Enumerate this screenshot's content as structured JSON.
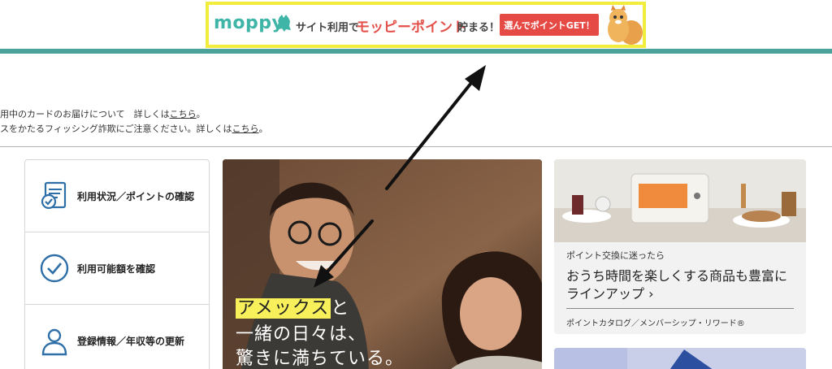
{
  "banner": {
    "logo": "moppy",
    "text_prefix": "サイト利用で",
    "text_points": "モッピーポイント",
    "text_suffix": "貯まる！",
    "cta_label": "選んでポイントGET！"
  },
  "notices": [
    {
      "text": "用中のカードのお届けについて　詳しくは",
      "link": "こちら",
      "after": "。"
    },
    {
      "text": "スをかたるフィッシング詐欺にご注意ください。詳しくは",
      "link": "こちら",
      "after": "。"
    }
  ],
  "side_menu": [
    {
      "label": "利用状況／ポイントの確認",
      "icon": "receipt-check-icon"
    },
    {
      "label": "利用可能額を確認",
      "icon": "check-circle-icon"
    },
    {
      "label": "登録情報／年収等の更新",
      "icon": "user-icon"
    }
  ],
  "hero": {
    "highlight": "アメックス",
    "line1_rest": "と",
    "line2": "一緒の日々は、",
    "line3": "驚きに満ちている。"
  },
  "card": {
    "sub": "ポイント交換に迷ったら",
    "title": "おうち時間を楽しくする商品も豊富にラインアップ ›",
    "footer": "ポイントカタログ／メンバーシップ・リワード®"
  },
  "colors": {
    "teal": "#4aa29a",
    "banner_border": "#f2ec3c",
    "cta_red": "#e54a45",
    "menu_icon_blue": "#2f6fa8",
    "highlight_yellow": "#f7f05a"
  }
}
